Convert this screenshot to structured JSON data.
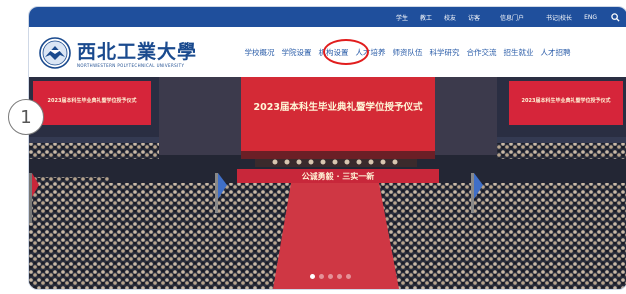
{
  "topbar": {
    "links": [
      "学生",
      "教工",
      "校友",
      "访客",
      "信息门户",
      "书记|校长",
      "ENG"
    ],
    "search_icon": "search-icon"
  },
  "header": {
    "logo_cn": "西北工業大學",
    "logo_en": "NORTHWESTERN POLYTECHNICAL UNIVERSITY",
    "logo_icon": "university-emblem-icon"
  },
  "nav": {
    "items": [
      "学校概况",
      "学院设置",
      "机构设置",
      "人才培养",
      "师资队伍",
      "科学研究",
      "合作交流",
      "招生就业",
      "人才招聘"
    ],
    "highlighted": "机构设置"
  },
  "hero": {
    "main_banner": "2023届本科生毕业典礼暨学位授予仪式",
    "left_banner": "2023届本科生毕业典礼暨学位授予仪式",
    "right_banner": "2023届本科生毕业典礼暨学位授予仪式",
    "motto": "公诚勇毅 · 三实一新",
    "slide_count": 5,
    "active_slide": 1
  },
  "annotation": {
    "label": "1"
  },
  "colors": {
    "topbar": "#1f4f9c",
    "brand": "#1a4a8e",
    "nav_text": "#2a5ca8",
    "highlight": "#e11d1d"
  }
}
